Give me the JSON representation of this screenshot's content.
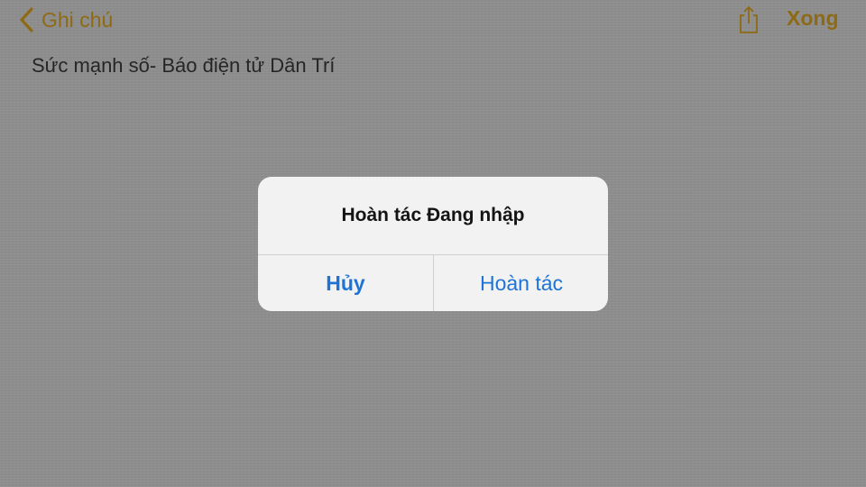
{
  "nav": {
    "back_label": "Ghi chú",
    "done_label": "Xong",
    "back_icon": "chevron-left-icon",
    "share_icon": "share-icon"
  },
  "note": {
    "text": "Sức mạnh số- Báo điện tử Dân Trí"
  },
  "alert": {
    "title": "Hoàn tác Đang nhập",
    "cancel_label": "Hủy",
    "undo_label": "Hoàn tác"
  },
  "colors": {
    "accent": "#8f6a14",
    "button_blue": "#1d73d6",
    "dimmed_background": "#8e8e8e",
    "alert_background": "#f2f2f2"
  }
}
